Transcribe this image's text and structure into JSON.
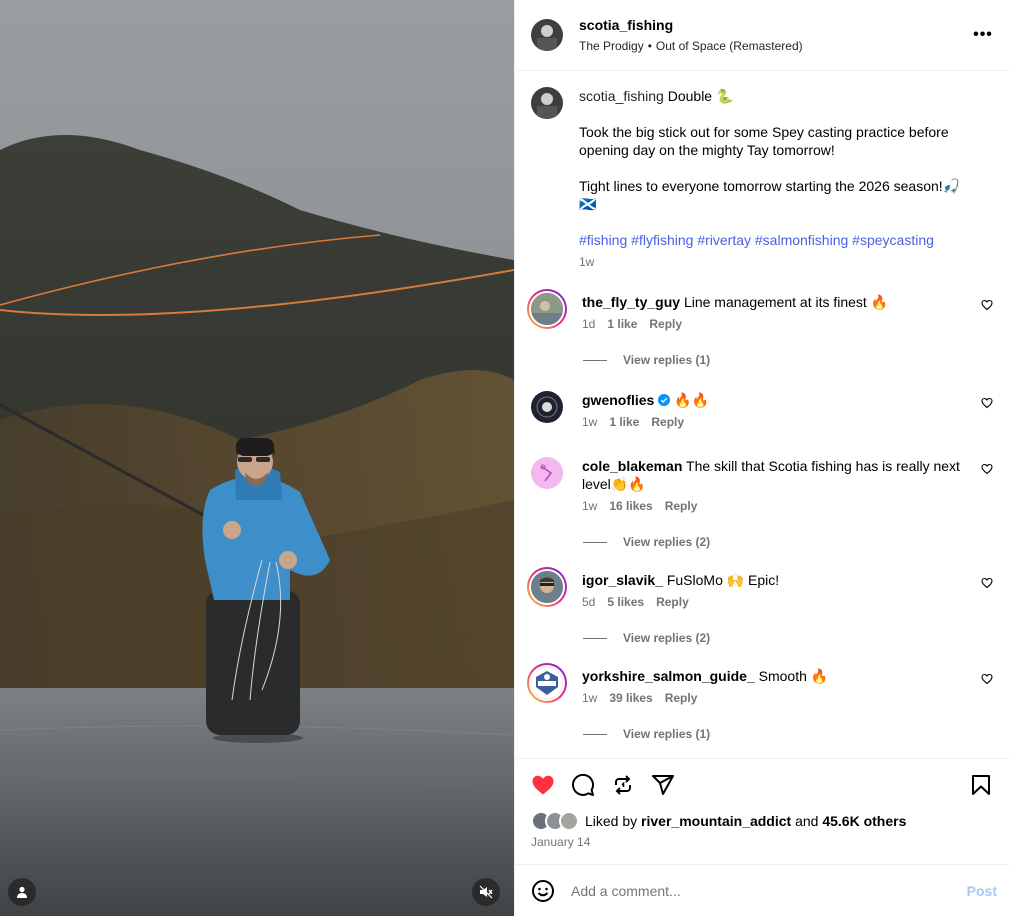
{
  "header": {
    "username": "scotia_fishing",
    "audio_artist": "The Prodigy",
    "audio_separator": "•",
    "audio_track": "Out of Space (Remastered)",
    "more_label": "•••"
  },
  "caption": {
    "username": "scotia_fishing",
    "title": "Double 🐍",
    "paragraph1": "Took the big stick out for some Spey casting practice before opening day on the mighty Tay tomorrow!",
    "paragraph2": "Tight lines to everyone tomorrow starting the 2026 season!🎣🏴󠁧󠁢󠁳󠁣󠁴󠁿",
    "hashtags": [
      "#fishing",
      "#flyfishing",
      "#rivertay",
      "#salmonfishing",
      "#speycasting"
    ],
    "time": "1w"
  },
  "comments": [
    {
      "username": "the_fly_ty_guy",
      "text": "Line management at its finest 🔥",
      "time": "1d",
      "likes": "1 like",
      "reply": "Reply",
      "replies": "View replies (1)",
      "story_ring": true,
      "avatar_color": "#8a9a86"
    },
    {
      "username": "gwenoflies",
      "verified": true,
      "text": "🔥🔥",
      "time": "1w",
      "likes": "1 like",
      "reply": "Reply",
      "replies": "",
      "story_ring": false,
      "avatar_color": "#1f2230"
    },
    {
      "username": "cole_blakeman",
      "text": "The skill that Scotia fishing has is really next level👏🔥",
      "time": "1w",
      "likes": "16 likes",
      "reply": "Reply",
      "replies": "View replies (2)",
      "story_ring": false,
      "avatar_color": "#f3b8f0"
    },
    {
      "username": "igor_slavik_",
      "text": "FuSloMo 🙌 Epic!",
      "time": "5d",
      "likes": "5 likes",
      "reply": "Reply",
      "replies": "View replies (2)",
      "story_ring": true,
      "avatar_color": "#6d7f8a"
    },
    {
      "username": "yorkshire_salmon_guide_",
      "text": "Smooth 🔥",
      "time": "1w",
      "likes": "39 likes",
      "reply": "Reply",
      "replies": "View replies (1)",
      "story_ring": true,
      "avatar_color": "#3a5f9a"
    }
  ],
  "engagement": {
    "liked_by_prefix": "Liked by",
    "liked_by_user": "river_mountain_addict",
    "and": "and",
    "others": "45.6K others",
    "date": "January 14"
  },
  "add_comment": {
    "placeholder": "Add a comment...",
    "post_label": "Post"
  },
  "colors": {
    "like_red": "#ff3040",
    "link_blue": "#4a5fe0",
    "post_blue": "#a5c8f5",
    "verified_blue": "#0095f6"
  }
}
